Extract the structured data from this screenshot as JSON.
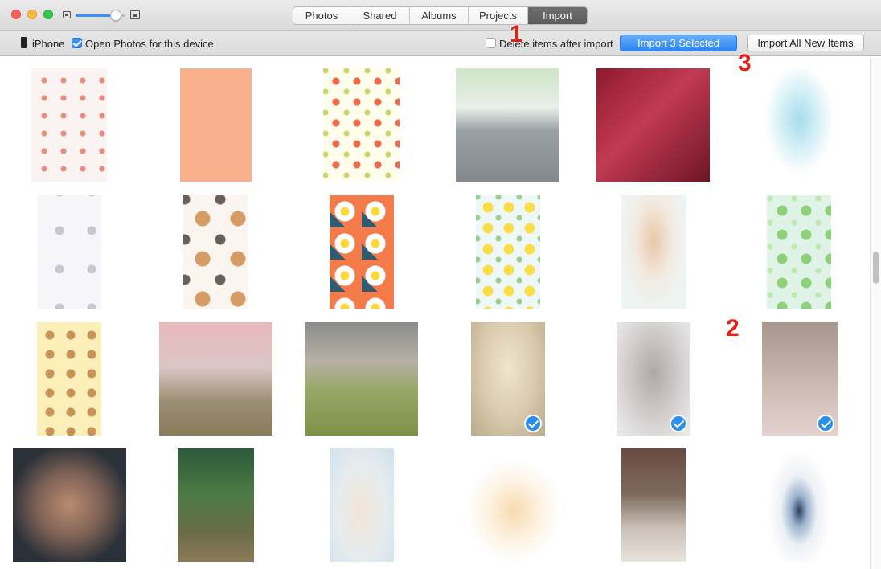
{
  "titlebar": {
    "tabs": [
      {
        "label": "Photos",
        "active": false
      },
      {
        "label": "Shared",
        "active": false
      },
      {
        "label": "Albums",
        "active": false
      },
      {
        "label": "Projects",
        "active": false
      },
      {
        "label": "Import",
        "active": true
      }
    ],
    "zoom_level": 0.8
  },
  "toolbar": {
    "device_name": "iPhone",
    "open_photos_label": "Open Photos for this device",
    "open_photos_checked": true,
    "delete_label": "Delete items after import",
    "delete_checked": false,
    "import_selected_label": "Import 3 Selected",
    "import_all_label": "Import All New Items"
  },
  "callouts": [
    "1",
    "2",
    "3"
  ],
  "photos": [
    {
      "id": "r1c1",
      "selected": false
    },
    {
      "id": "r1c2",
      "selected": false
    },
    {
      "id": "r1c3",
      "selected": false
    },
    {
      "id": "r1c4",
      "selected": false
    },
    {
      "id": "r1c5",
      "selected": false
    },
    {
      "id": "r1c6",
      "selected": false
    },
    {
      "id": "r2c1",
      "selected": false
    },
    {
      "id": "r2c2",
      "selected": false
    },
    {
      "id": "r2c3",
      "selected": false
    },
    {
      "id": "r2c4",
      "selected": false
    },
    {
      "id": "r2c5",
      "selected": false
    },
    {
      "id": "r2c6",
      "selected": false
    },
    {
      "id": "r3c1",
      "selected": false
    },
    {
      "id": "r3c2",
      "selected": false
    },
    {
      "id": "r3c3",
      "selected": false
    },
    {
      "id": "r3c4",
      "selected": true
    },
    {
      "id": "r3c5",
      "selected": true
    },
    {
      "id": "r3c6",
      "selected": true
    },
    {
      "id": "r4c1",
      "selected": false
    },
    {
      "id": "r4c2",
      "selected": false
    },
    {
      "id": "r4c3",
      "selected": false
    },
    {
      "id": "r4c4",
      "selected": false
    },
    {
      "id": "r4c5",
      "selected": false
    },
    {
      "id": "r4c6",
      "selected": false
    }
  ],
  "colors": {
    "accent": "#2b86f4",
    "callout": "#e02418",
    "active_tab": "#5c5c5c"
  }
}
